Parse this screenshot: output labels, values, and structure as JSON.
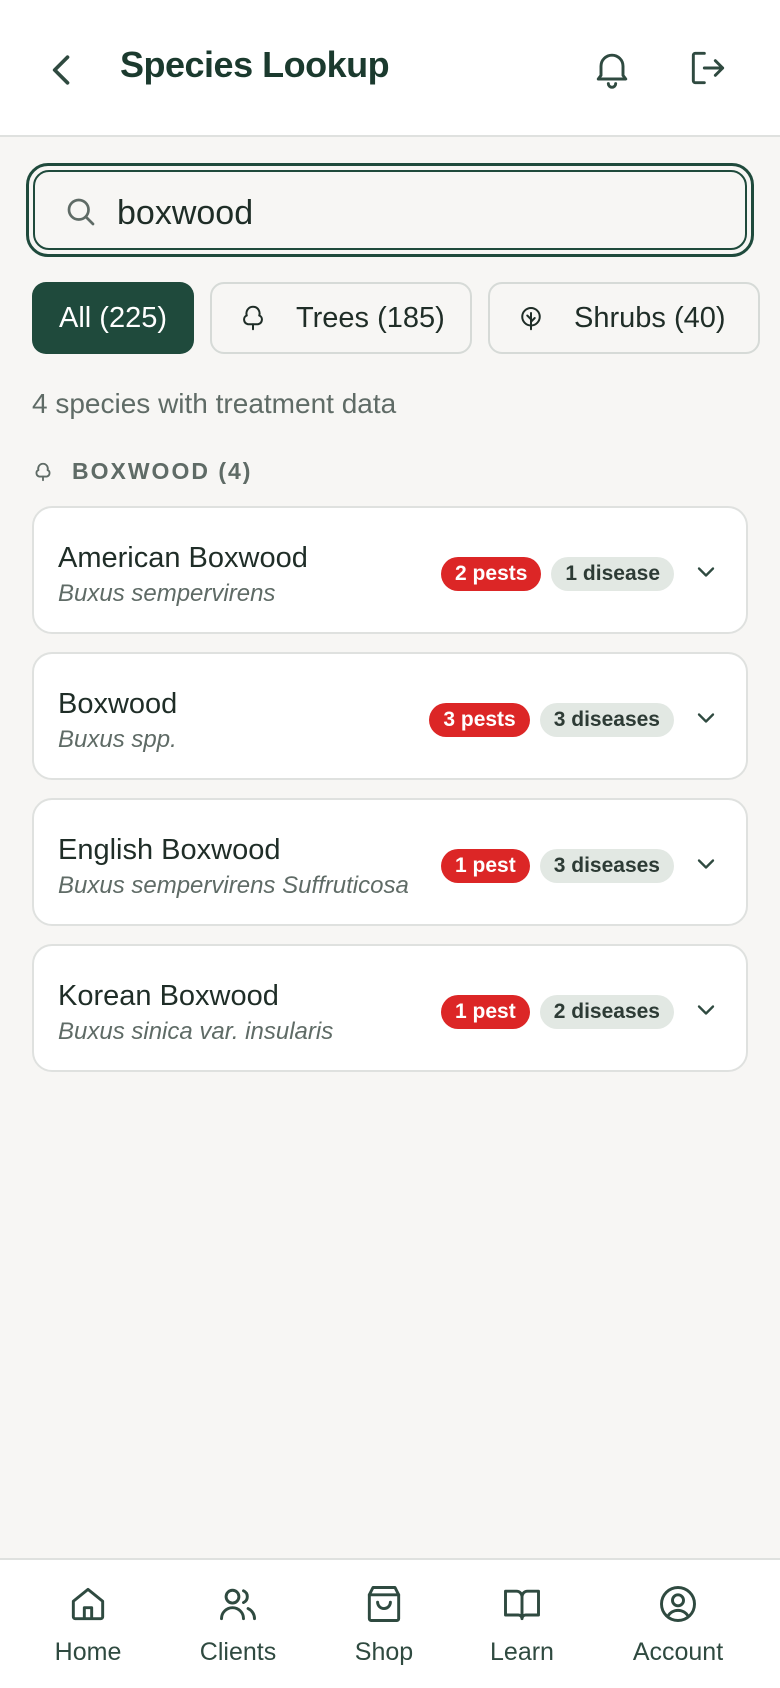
{
  "header": {
    "title": "Species Lookup",
    "back_icon": "chevron-left-icon",
    "notifications_icon": "bell-icon",
    "logout_icon": "logout-icon"
  },
  "search": {
    "value": "boxwood",
    "placeholder": "Search species"
  },
  "filters": [
    {
      "label": "All (225)",
      "active": true
    },
    {
      "label": "Trees (185)",
      "icon": "tree-icon",
      "active": false
    },
    {
      "label": "Shrubs (40)",
      "icon": "shrub-icon",
      "active": false
    }
  ],
  "result_count": "4 species with treatment data",
  "group": {
    "label": "BOXWOOD (4)",
    "icon": "tree-icon"
  },
  "species": [
    {
      "name": "American Boxwood",
      "scientific": "Buxus sempervirens",
      "pests": "2 pests",
      "diseases": "1 disease"
    },
    {
      "name": "Boxwood",
      "scientific": "Buxus spp.",
      "pests": "3 pests",
      "diseases": "3 diseases"
    },
    {
      "name": "English Boxwood",
      "scientific": "Buxus sempervirens Suffruticosa",
      "pests": "1 pest",
      "diseases": "3 diseases"
    },
    {
      "name": "Korean Boxwood",
      "scientific": "Buxus sinica var. insularis",
      "pests": "1 pest",
      "diseases": "2 diseases"
    }
  ],
  "nav": [
    {
      "label": "Home",
      "icon": "home-icon"
    },
    {
      "label": "Clients",
      "icon": "users-icon"
    },
    {
      "label": "Shop",
      "icon": "shopping-bag-icon"
    },
    {
      "label": "Learn",
      "icon": "book-icon"
    },
    {
      "label": "Account",
      "icon": "user-circle-icon"
    }
  ],
  "colors": {
    "brand": "#1f4a3c",
    "background": "#f7f6f4",
    "pest_badge": "#dc2626",
    "disease_badge": "#e2e8e3"
  }
}
